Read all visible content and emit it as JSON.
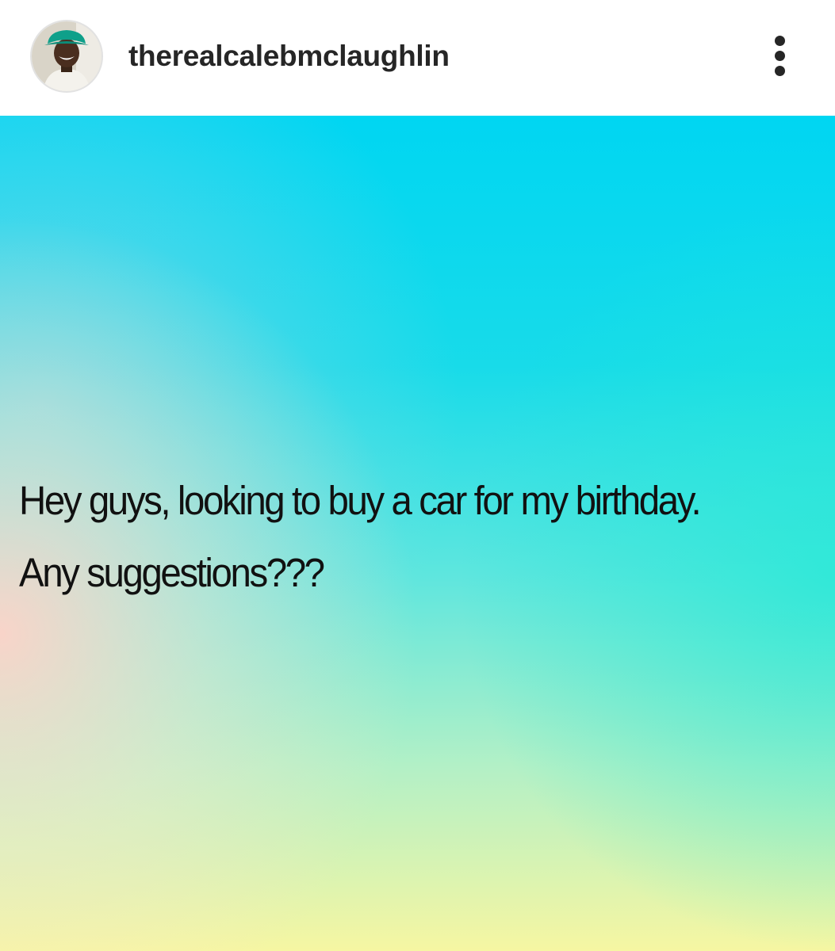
{
  "header": {
    "username": "therealcalebmclaughlin",
    "more_icon": "more-vertical-icon",
    "avatar_icon": "profile-photo"
  },
  "post": {
    "caption_line_1": "Hey guys, looking to buy a car for my birthday.",
    "caption_line_2": "Any suggestions???",
    "background_colors": {
      "top": "#00d8f0",
      "middle": "#5ee6de",
      "bottom": "#f3f7a6",
      "left_glow": "#ffd5c8"
    },
    "text_color": "#111111"
  }
}
